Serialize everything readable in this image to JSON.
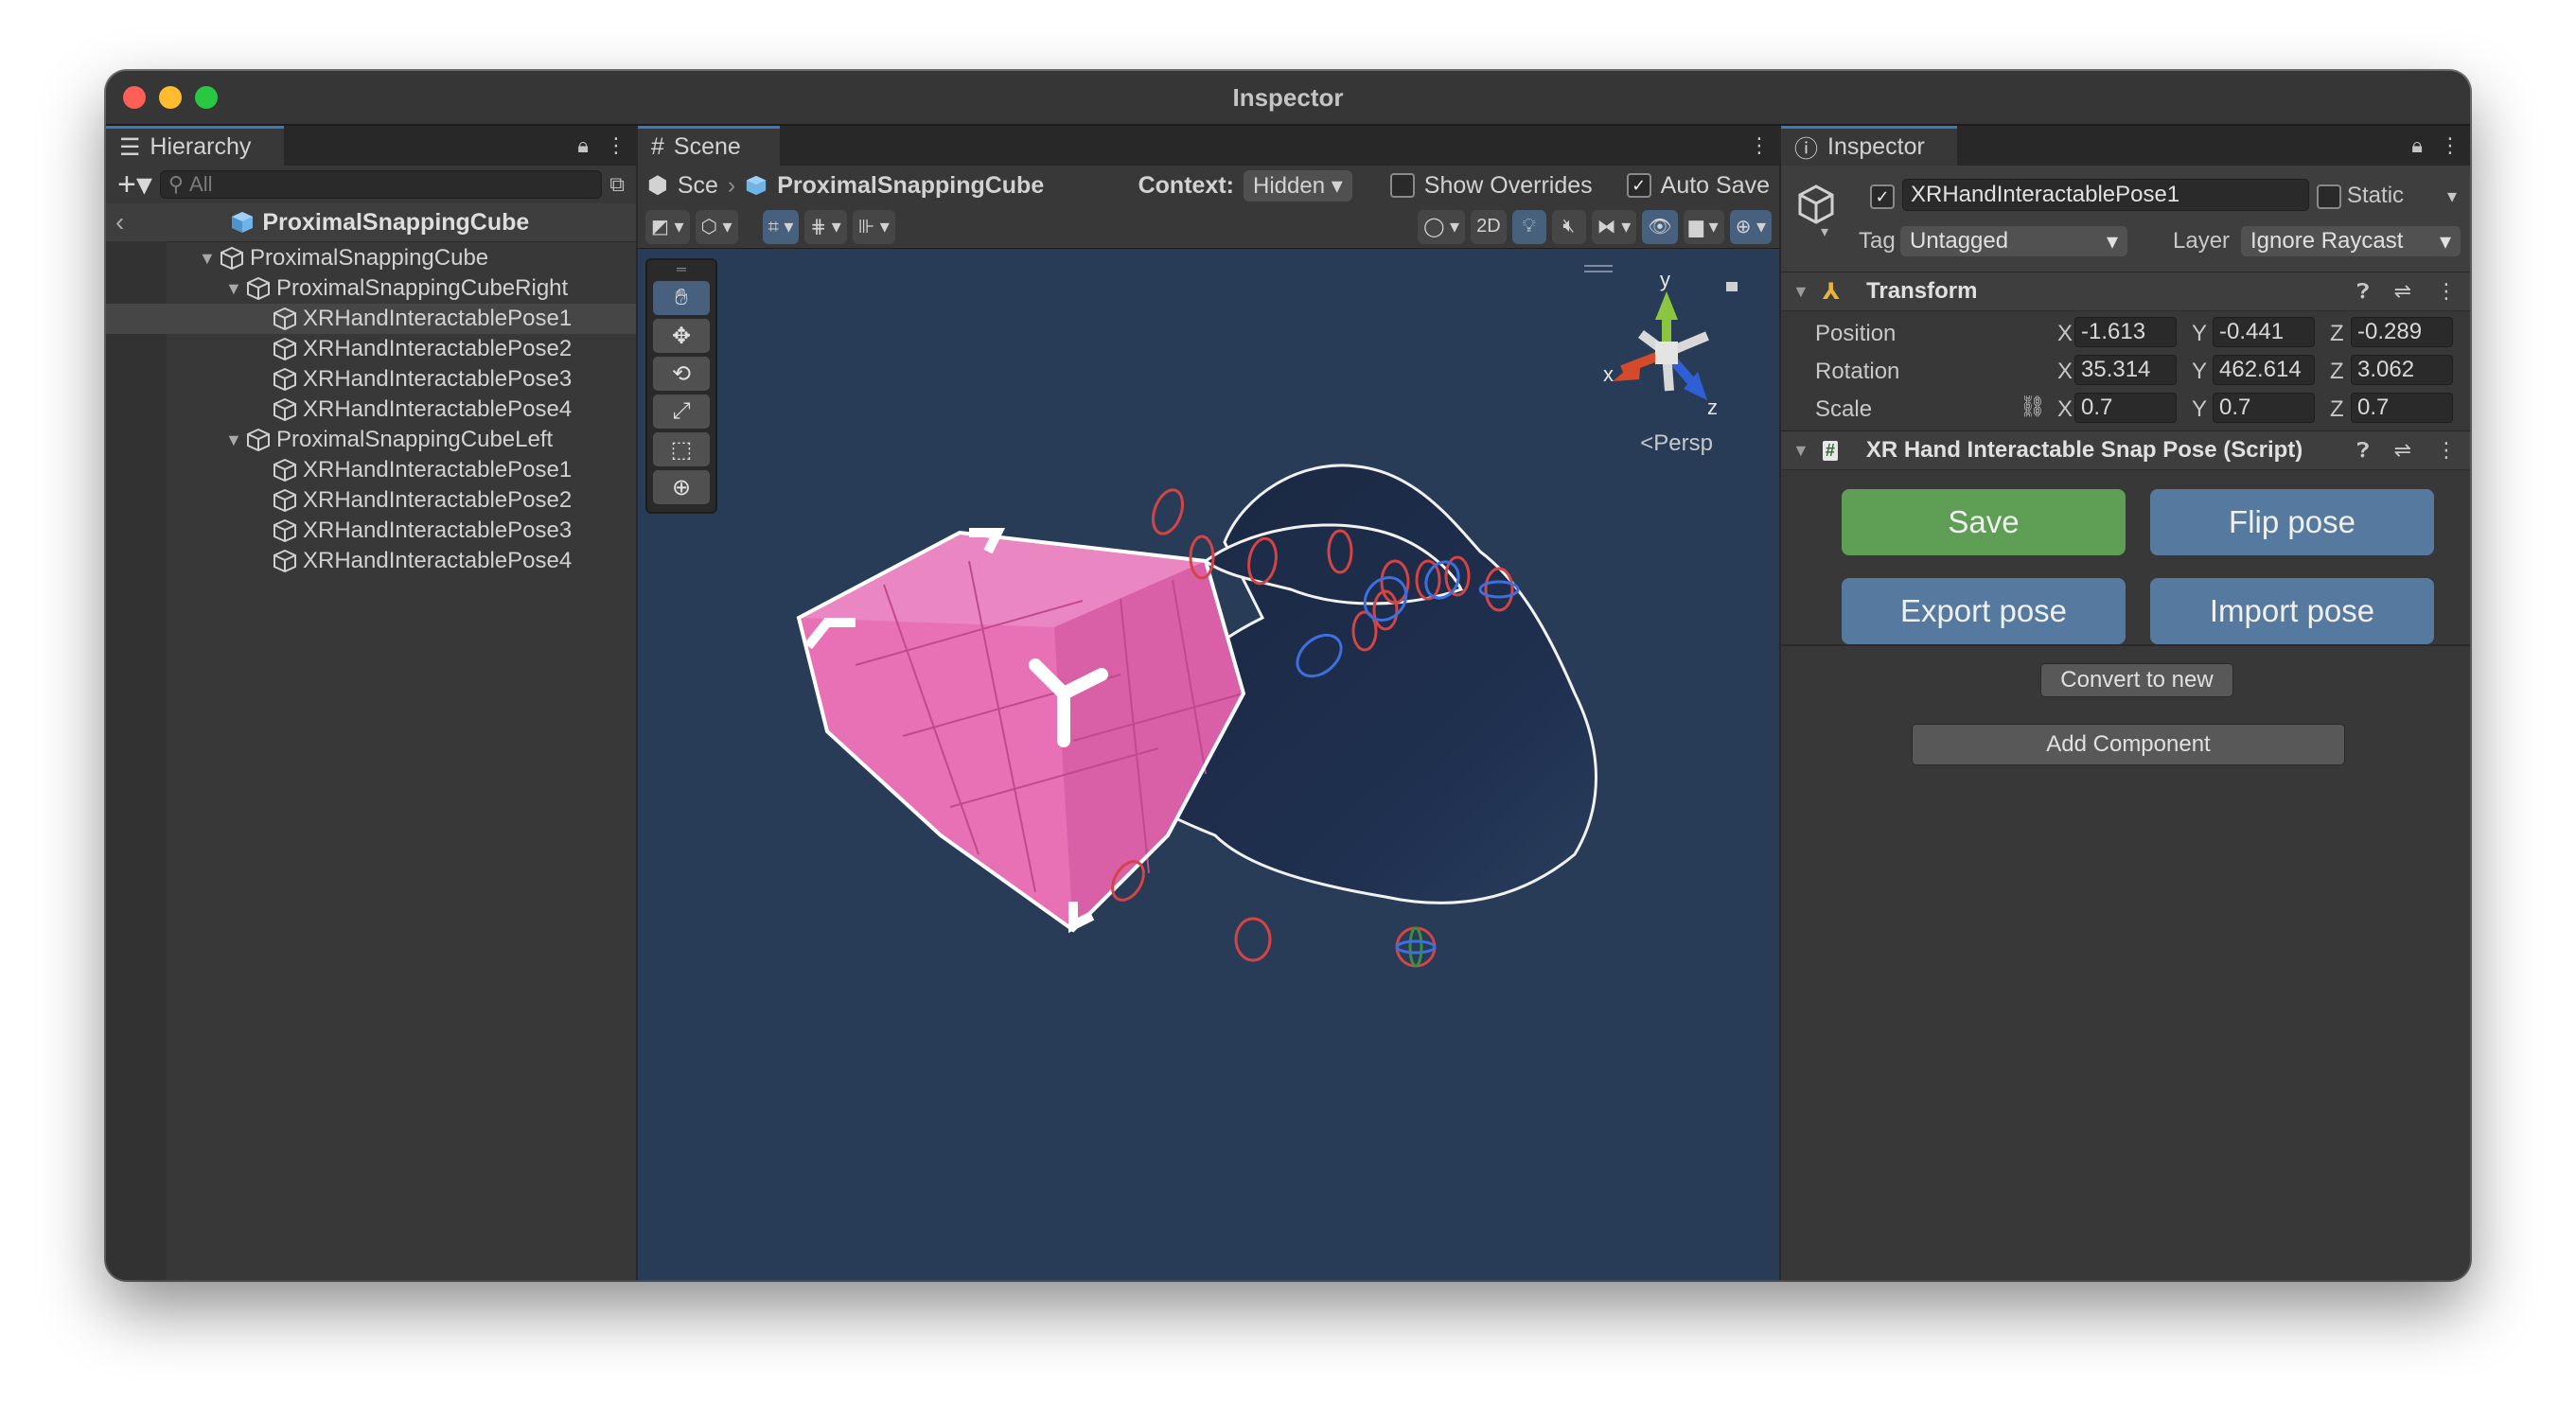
{
  "window": {
    "title": "Inspector"
  },
  "hierarchy": {
    "tab_label": "Hierarchy",
    "search_placeholder": "All",
    "scene_name": "ProximalSnappingCube",
    "rows": [
      {
        "label": "ProximalSnappingCube",
        "depth": 0,
        "expanded": true,
        "selected": false
      },
      {
        "label": "ProximalSnappingCubeRight",
        "depth": 1,
        "expanded": true,
        "selected": false
      },
      {
        "label": "XRHandInteractablePose1",
        "depth": 2,
        "expanded": null,
        "selected": true
      },
      {
        "label": "XRHandInteractablePose2",
        "depth": 2,
        "expanded": null,
        "selected": false
      },
      {
        "label": "XRHandInteractablePose3",
        "depth": 2,
        "expanded": null,
        "selected": false
      },
      {
        "label": "XRHandInteractablePose4",
        "depth": 2,
        "expanded": null,
        "selected": false
      },
      {
        "label": "ProximalSnappingCubeLeft",
        "depth": 1,
        "expanded": true,
        "selected": false
      },
      {
        "label": "XRHandInteractablePose1",
        "depth": 2,
        "expanded": null,
        "selected": false
      },
      {
        "label": "XRHandInteractablePose2",
        "depth": 2,
        "expanded": null,
        "selected": false
      },
      {
        "label": "XRHandInteractablePose3",
        "depth": 2,
        "expanded": null,
        "selected": false
      },
      {
        "label": "XRHandInteractablePose4",
        "depth": 2,
        "expanded": null,
        "selected": false
      }
    ]
  },
  "scene": {
    "tab_label": "Scene",
    "breadcrumb_root": "Sce",
    "breadcrumb_object": "ProximalSnappingCube",
    "context_label": "Context:",
    "context_value": "Hidden",
    "show_overrides_label": "Show Overrides",
    "show_overrides_checked": false,
    "auto_save_label": "Auto Save",
    "auto_save_checked": true,
    "mode_2d_label": "2D",
    "projection_label": "Persp",
    "gizmo_axes": {
      "x": "x",
      "y": "y",
      "z": "z"
    }
  },
  "inspector": {
    "tab_label": "Inspector",
    "object_name": "XRHandInteractablePose1",
    "active_checked": true,
    "static_label": "Static",
    "static_checked": false,
    "tag_label": "Tag",
    "tag_value": "Untagged",
    "layer_label": "Layer",
    "layer_value": "Ignore Raycast",
    "transform": {
      "title": "Transform",
      "position_label": "Position",
      "rotation_label": "Rotation",
      "scale_label": "Scale",
      "position": {
        "x": "-1.613",
        "y": "-0.441",
        "z": "-0.289"
      },
      "rotation": {
        "x": "35.314",
        "y": "462.614",
        "z": "3.062"
      },
      "scale": {
        "x": "0.7",
        "y": "0.7",
        "z": "0.7"
      },
      "axis_labels": {
        "x": "X",
        "y": "Y",
        "z": "Z"
      }
    },
    "script_component": {
      "title": "XR Hand Interactable Snap Pose (Script)",
      "save_label": "Save",
      "flip_label": "Flip pose",
      "export_label": "Export pose",
      "import_label": "Import pose",
      "convert_label": "Convert to new"
    },
    "add_component_label": "Add Component"
  },
  "colors": {
    "save_green": "#5f9f55",
    "pose_blue": "#56799f",
    "cube_pink": "#e871b6",
    "scene_bg": "#283c58",
    "accent_tab": "#3a79bb"
  }
}
